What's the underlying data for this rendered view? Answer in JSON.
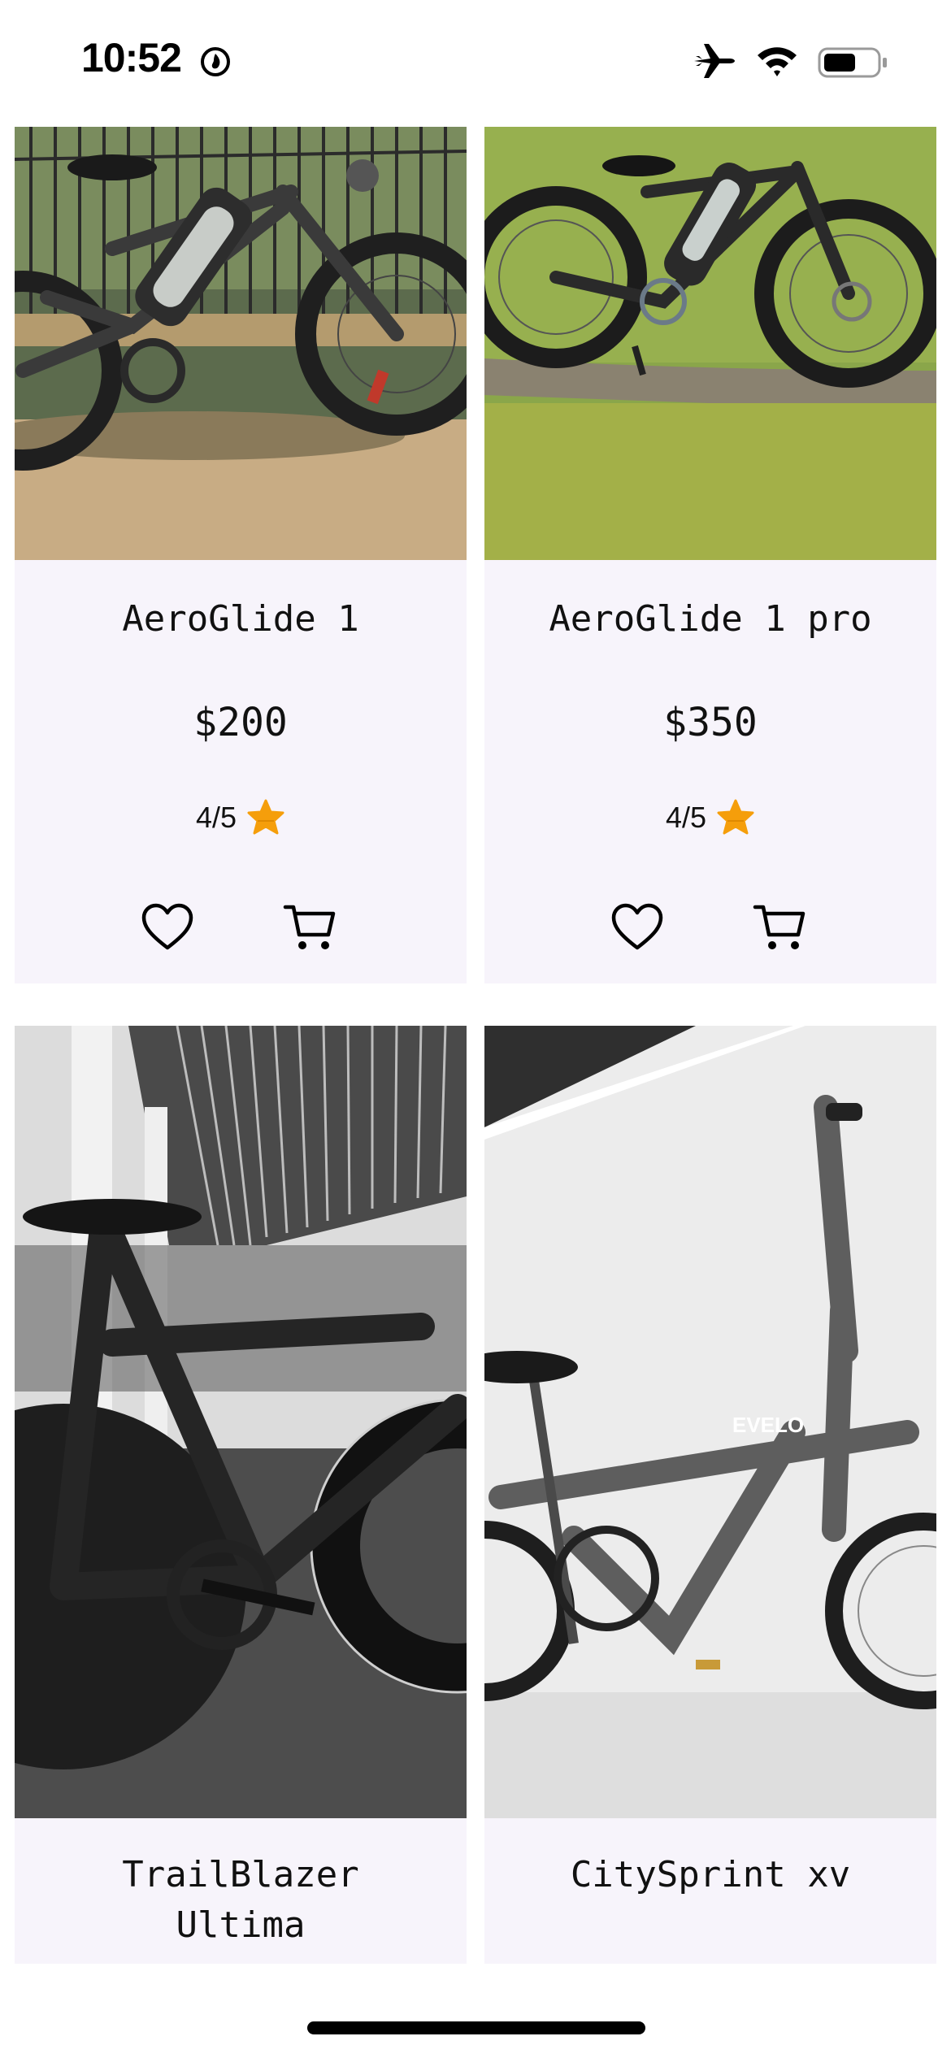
{
  "status_bar": {
    "time": "10:52"
  },
  "products": [
    {
      "name": "AeroGlide 1",
      "price": "$200",
      "rating": "4/5"
    },
    {
      "name": "AeroGlide 1 pro",
      "price": "$350",
      "rating": "4/5"
    },
    {
      "name": "TrailBlazer Ultima"
    },
    {
      "name": "CitySprint xv"
    }
  ],
  "icons": {
    "rating": "star-icon",
    "favorite": "heart-icon",
    "cart": "cart-icon"
  },
  "colors": {
    "card_background": "#f7f4fb",
    "star": "#f59e0b",
    "text": "#111111"
  },
  "image_text": {
    "brand_on_frame": "EVELO"
  }
}
